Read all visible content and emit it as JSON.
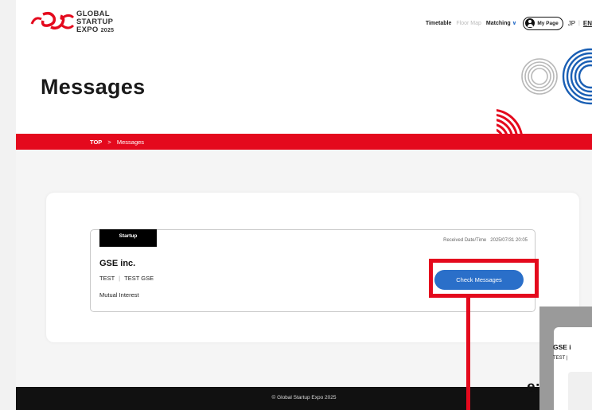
{
  "header": {
    "logo_lines": [
      "GLOBAL",
      "STARTUP",
      "EXPO"
    ],
    "logo_year": "2025",
    "nav": {
      "timetable": "Timetable",
      "floor_map": "Floor Map",
      "matching": "Matching",
      "my_page": "My Page",
      "lang_jp": "JP",
      "lang_en": "EN"
    }
  },
  "hero": {
    "title": "Messages"
  },
  "breadcrumb": {
    "top": "TOP",
    "separator": ">",
    "current": "Messages"
  },
  "message": {
    "tag": "Startup",
    "received_label": "Received Date/Time",
    "received_value": "2025/07/31 20:05",
    "company": "GSE inc.",
    "person_first": "TEST",
    "person_second": "TEST GSE",
    "status": "Mutual Interest",
    "button": "Check Messages"
  },
  "footer": {
    "copyright": "© Global Startup Expo 2025"
  },
  "overlay": {
    "company": "GSE i",
    "people": "TEST",
    "partial_text": "e:"
  },
  "colors": {
    "brand_red": "#e4091d",
    "button_blue": "#2a6fc9",
    "footer_black": "#111111"
  }
}
